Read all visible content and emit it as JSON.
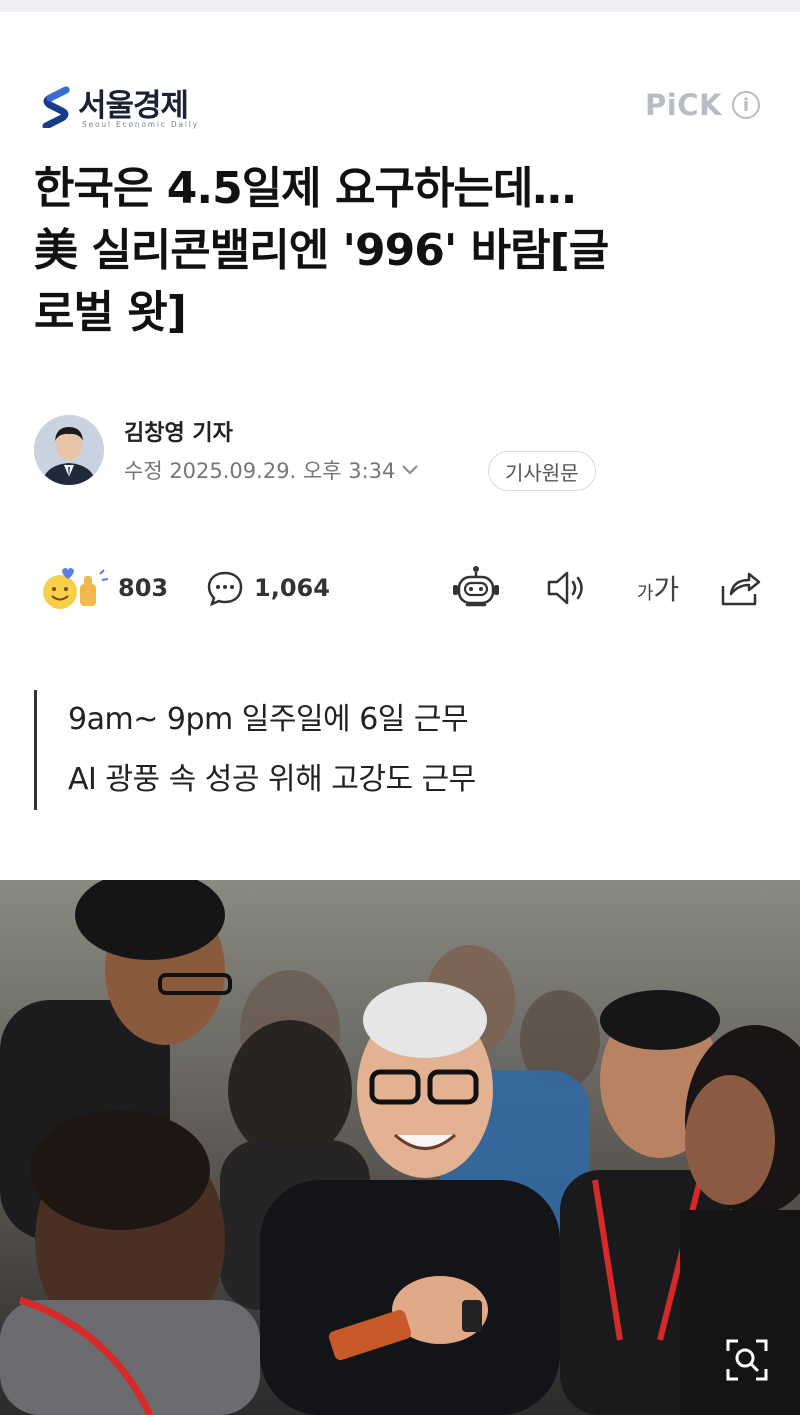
{
  "publisher": {
    "name": "서울경제",
    "subtitle": "Seoul Economic Daily",
    "pick_label": "PiCK",
    "info_symbol": "i"
  },
  "article": {
    "headline_lines": [
      "한국은 4.5일제 요구하는데…",
      "美 실리콘밸리엔 '996' 바람[글",
      "로벌 왓]"
    ],
    "author": {
      "name": "김창영 기자",
      "modified": "수정 2025.09.29. 오후 3:34",
      "original_button": "기사원문"
    },
    "summary_lines": [
      "9am~ 9pm 일주일에 6일 근무",
      "AI 광풍 속 성공 위해 고강도 근무"
    ]
  },
  "actions": {
    "reaction_count": "803",
    "comment_count": "1,064",
    "font_size_small": "가",
    "font_size_large": "가"
  },
  "icons": {
    "reaction": "reaction-emoji-icon",
    "comment": "comment-bubble-icon",
    "robot": "ai-summary-robot-icon",
    "speaker": "speaker-icon",
    "share": "share-icon",
    "chevron": "chevron-down-icon",
    "zoom": "zoom-search-icon"
  },
  "colors": {
    "brand_navy": "#1a2233",
    "muted_gray": "#b8bcc4",
    "lanyard_red": "#d62a2a"
  }
}
